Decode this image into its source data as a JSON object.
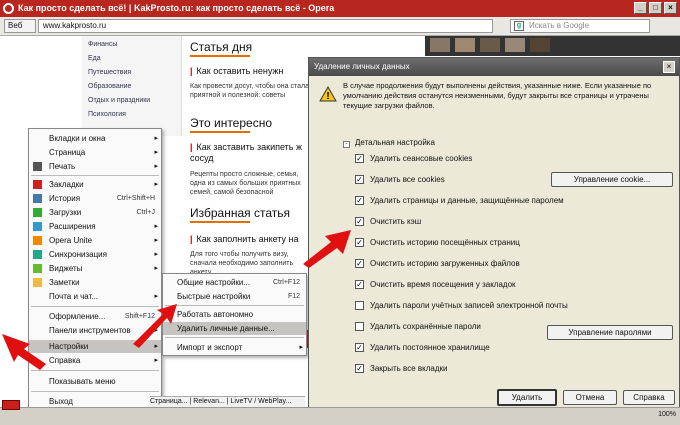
{
  "window": {
    "title": "Как просто сделать всё! | KakProsto.ru: как просто сделать всё - Opera",
    "min": "_",
    "max": "□",
    "close": "×"
  },
  "address": {
    "web_label": "Веб",
    "url": "www.kakprosto.ru",
    "search_placeholder": "Искать в Google",
    "search_engine_glyph": "g"
  },
  "site": {
    "nav": [
      "Финансы",
      "Еда",
      "Путешествия",
      "Образование",
      "Отдых и праздники",
      "Психология"
    ],
    "section1": "Статья дня",
    "link1": "Как оставить ненужн",
    "snippet1": "Как провести досуг, чтобы она стала приятной и полезной: советы",
    "section2": "Это интересно",
    "link2": "Как заставить закипеть ж сосуд",
    "snippet2": "Рецепты просто сложные, семья, одна из самых больших приятных семей, самой безопасной",
    "section3": "Избранная статья",
    "link3": "Как заполнить анкету на",
    "snippet3": "Для того чтобы получить визу, сначала необходимо заполнить анкету"
  },
  "menu": {
    "items": [
      {
        "label": "Вкладки и окна",
        "arrow": "▸"
      },
      {
        "label": "Страница",
        "arrow": "▸"
      },
      {
        "label": "Печать",
        "arrow": "▸"
      },
      {
        "label": "Закладки",
        "arrow": "▸"
      },
      {
        "label": "История",
        "shortcut": "Ctrl+Shift+H"
      },
      {
        "label": "Загрузки",
        "shortcut": "Ctrl+J"
      },
      {
        "label": "Расширения",
        "arrow": "▸"
      },
      {
        "label": "Opera Unite",
        "arrow": "▸"
      },
      {
        "label": "Синхронизация",
        "arrow": "▸"
      },
      {
        "label": "Виджеты",
        "arrow": "▸"
      },
      {
        "label": "Заметки"
      },
      {
        "label": "Почта и чат...",
        "arrow": "▸"
      },
      {
        "label": "Оформление...",
        "shortcut": "Shift+F12"
      },
      {
        "label": "Панели инструментов",
        "arrow": "▸"
      },
      {
        "label": "Настройки",
        "arrow": "▸"
      },
      {
        "label": "Справка",
        "arrow": "▸"
      },
      {
        "label": "Показывать меню"
      },
      {
        "label": "Выход"
      }
    ]
  },
  "submenu": {
    "items": [
      {
        "label": "Общие настройки...",
        "shortcut": "Ctrl+F12"
      },
      {
        "label": "Быстрые настройки",
        "shortcut": "F12"
      },
      {
        "label": "Работать автономно"
      },
      {
        "label": "Удалить личные данные..."
      },
      {
        "label": "Импорт и экспорт",
        "arrow": "▸"
      }
    ]
  },
  "dialog": {
    "title": "Удаление личных данных",
    "info": "В случае продолжения будут выполнены действия, указанные ниже. Если указанные по умолчанию действия останутся неизменными, будут закрыты все страницы и утрачены текущие загрузки файлов.",
    "toggle_label": "Детальная настройка",
    "toggle_sign": "-",
    "options": [
      {
        "label": "Удалить сеансовые cookies",
        "checked": true
      },
      {
        "label": "Удалить все cookies",
        "checked": true
      },
      {
        "label": "Удалить страницы и данные, защищённые паролем",
        "checked": true
      },
      {
        "label": "Очистить кэш",
        "checked": true
      },
      {
        "label": "Очистить историю посещённых страниц",
        "checked": true
      },
      {
        "label": "Очистить историю загруженных файлов",
        "checked": true
      },
      {
        "label": "Очистить время посещения у закладок",
        "checked": true
      },
      {
        "label": "Удалить пароли учётных записей электронной почты",
        "checked": false
      },
      {
        "label": "Удалить сохранённые пароли",
        "checked": false
      },
      {
        "label": "Удалить постоянное хранилище",
        "checked": true
      },
      {
        "label": "Закрыть все вкладки",
        "checked": true
      }
    ],
    "manage_cookies": "Управление cookie...",
    "manage_passwords": "Управление паролями",
    "delete": "Удалить",
    "cancel": "Отмена",
    "help": "Справка",
    "check_glyph": "✓",
    "close_glyph": "×",
    "warning_glyph": "!"
  },
  "bottom": {
    "tab1": "Страница...",
    "tab2": "Relevan...",
    "tab3": "LiveTV / WebPlay...",
    "zoom": "100%"
  },
  "colors": {
    "title_red": "#b7271f",
    "arrow_red": "#e01010",
    "highlight": "#c6c4c0"
  }
}
